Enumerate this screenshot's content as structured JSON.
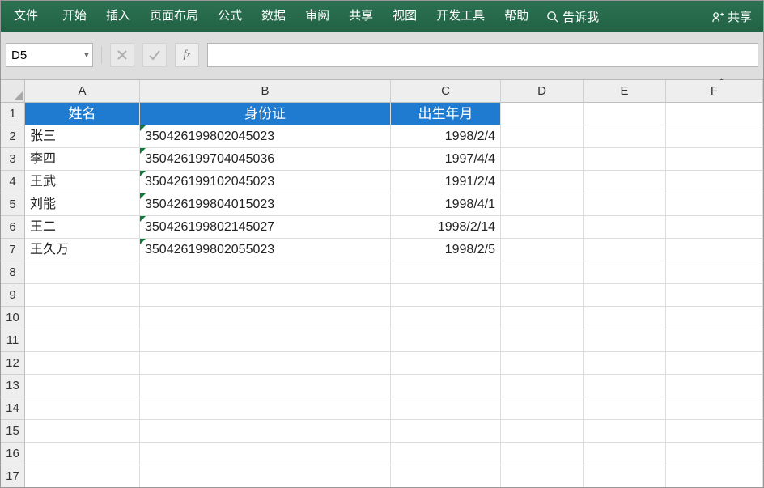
{
  "ribbon": {
    "tabs": [
      "文件",
      "开始",
      "插入",
      "页面布局",
      "公式",
      "数据",
      "审阅",
      "共享",
      "视图",
      "开发工具",
      "帮助"
    ],
    "tell_me": "告诉我",
    "share": "共享"
  },
  "formula_bar": {
    "cell_ref": "D5",
    "formula": ""
  },
  "columns": [
    "A",
    "B",
    "C",
    "D",
    "E",
    "F"
  ],
  "row_count": 17,
  "header_row": {
    "A": "姓名",
    "B": "身份证",
    "C": "出生年月"
  },
  "data_rows": [
    {
      "A": "张三",
      "B": "350426199802045023",
      "C": "1998/2/4"
    },
    {
      "A": "李四",
      "B": "350426199704045036",
      "C": "1997/4/4"
    },
    {
      "A": "王武",
      "B": "350426199102045023",
      "C": "1991/2/4"
    },
    {
      "A": "刘能",
      "B": "350426199804015023",
      "C": "1998/4/1"
    },
    {
      "A": "王二",
      "B": "350426199802145027",
      "C": "1998/2/14"
    },
    {
      "A": "王久万",
      "B": "350426199802055023",
      "C": "1998/2/5"
    }
  ]
}
